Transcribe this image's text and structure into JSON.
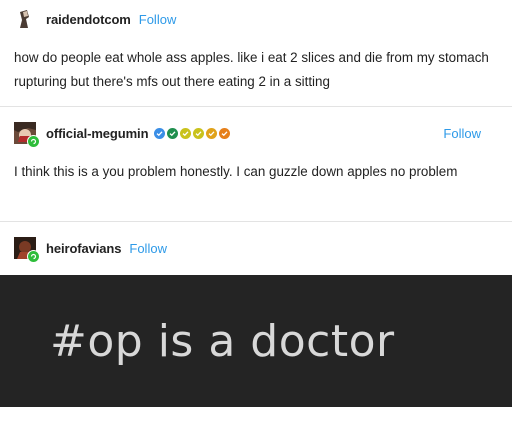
{
  "posts": [
    {
      "username": "raidendotcom",
      "follow_label": "Follow",
      "text": "how do people eat whole ass apples. like i eat 2 slices and die from my stomach rupturing but there's mfs out there eating 2 in a sitting"
    },
    {
      "username": "official-megumin",
      "follow_label": "Follow",
      "text": "I think this is a you problem honestly. I can guzzle down apples no problem",
      "check_badge_colors": [
        "#3a8ee6",
        "#1f8f4e",
        "#c9c21c",
        "#c9c21c",
        "#e0a21a",
        "#e67f1a"
      ]
    },
    {
      "username": "heirofavians",
      "follow_label": "Follow"
    }
  ],
  "image_caption": "#op is a doctor",
  "colors": {
    "follow": "#2e9ae8",
    "image_bg": "#242424",
    "image_text": "#d8d8d8",
    "online_badge": "#2dbd3a"
  }
}
